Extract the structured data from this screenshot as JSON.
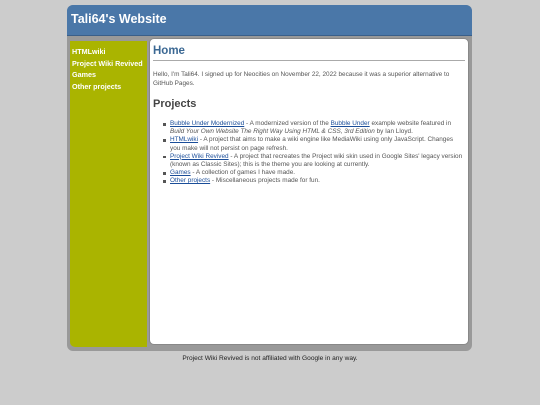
{
  "header": {
    "title": "Tali64's Website"
  },
  "sidebar": {
    "items": [
      {
        "label": "HTMLwiki"
      },
      {
        "label": "Project Wiki Revived"
      },
      {
        "label": "Games"
      },
      {
        "label": "Other projects"
      }
    ]
  },
  "main": {
    "heading": "Home",
    "intro": "Hello, I'm Tali64. I signed up for Neocities on November 22, 2022 because it was a superior alternative to GitHub Pages.",
    "projects_heading": "Projects",
    "projects": [
      {
        "link": "Bubble Under Modernized",
        "t1": " - A modernized version of the ",
        "link2": "Bubble Under",
        "t2": " example website featured in ",
        "em": "Build Your Own Website The Right Way Using HTML & CSS, 3rd Edition",
        "t3": " by Ian Lloyd."
      },
      {
        "link": "HTMLwiki",
        "t1": " - A project that aims to make a wiki engine like MediaWiki using only JavaScript. Changes you make will not persist on page refresh."
      },
      {
        "link": "Project Wiki Revived",
        "t1": " - A project that recreates the Project wiki skin used in Google Sites' legacy version (known as Classic Sites); this is the theme you are looking at currently."
      },
      {
        "link": "Games",
        "t1": " - A collection of games I have made."
      },
      {
        "link": "Other projects",
        "t1": " - Miscellaneous projects made for fun."
      }
    ]
  },
  "footer": {
    "text": "Project Wiki Revived is not affiliated with Google in any way."
  },
  "colors": {
    "header": "#4a77a8",
    "sidebar": "#aab400",
    "frame": "#999999",
    "background": "#cccccc",
    "link": "#1a4d99",
    "heading": "#3b6893"
  }
}
